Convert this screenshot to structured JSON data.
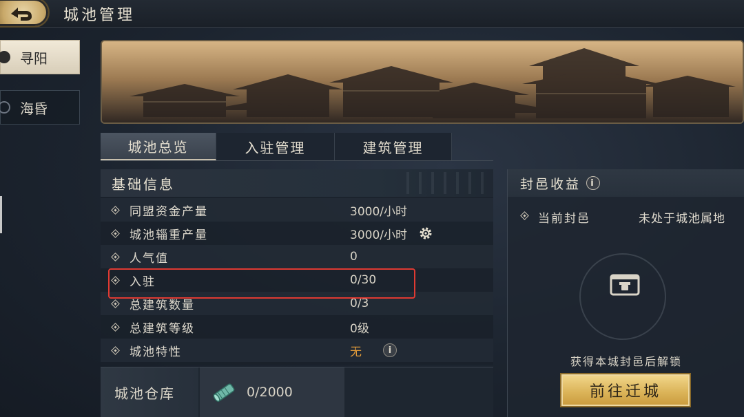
{
  "header": {
    "title": "城池管理"
  },
  "cities": [
    {
      "name": "寻阳",
      "selected": true
    },
    {
      "name": "海昏",
      "selected": false
    }
  ],
  "tabs": [
    {
      "label": "城池总览",
      "active": true
    },
    {
      "label": "入驻管理",
      "active": false
    },
    {
      "label": "建筑管理",
      "active": false
    }
  ],
  "basic_info": {
    "title": "基础信息",
    "rows": [
      {
        "label": "同盟资金产量",
        "value": "3000/小时"
      },
      {
        "label": "城池辎重产量",
        "value": "3000/小时"
      },
      {
        "label": "人气值",
        "value": "0"
      },
      {
        "label": "入驻",
        "value": "0/30"
      },
      {
        "label": "总建筑数量",
        "value": "0/3"
      },
      {
        "label": "总建筑等级",
        "value": "0级"
      },
      {
        "label": "城池特性",
        "value": "无"
      }
    ]
  },
  "warehouse": {
    "title": "城池仓库",
    "count": "0/2000"
  },
  "fief": {
    "title": "封邑收益",
    "info_glyph": "i",
    "current_label": "当前封邑",
    "current_value": "未处于城池属地",
    "unlock_text": "获得本城封邑后解锁",
    "button_label": "前往迁城"
  },
  "colors": {
    "accent_gold": "#dcb55a",
    "highlight_red": "#e03a32",
    "value_orange": "#e09a3a"
  },
  "icons": [
    "back-arrow-icon",
    "gear-icon",
    "info-icon",
    "scroll-icon",
    "lock-icon"
  ]
}
